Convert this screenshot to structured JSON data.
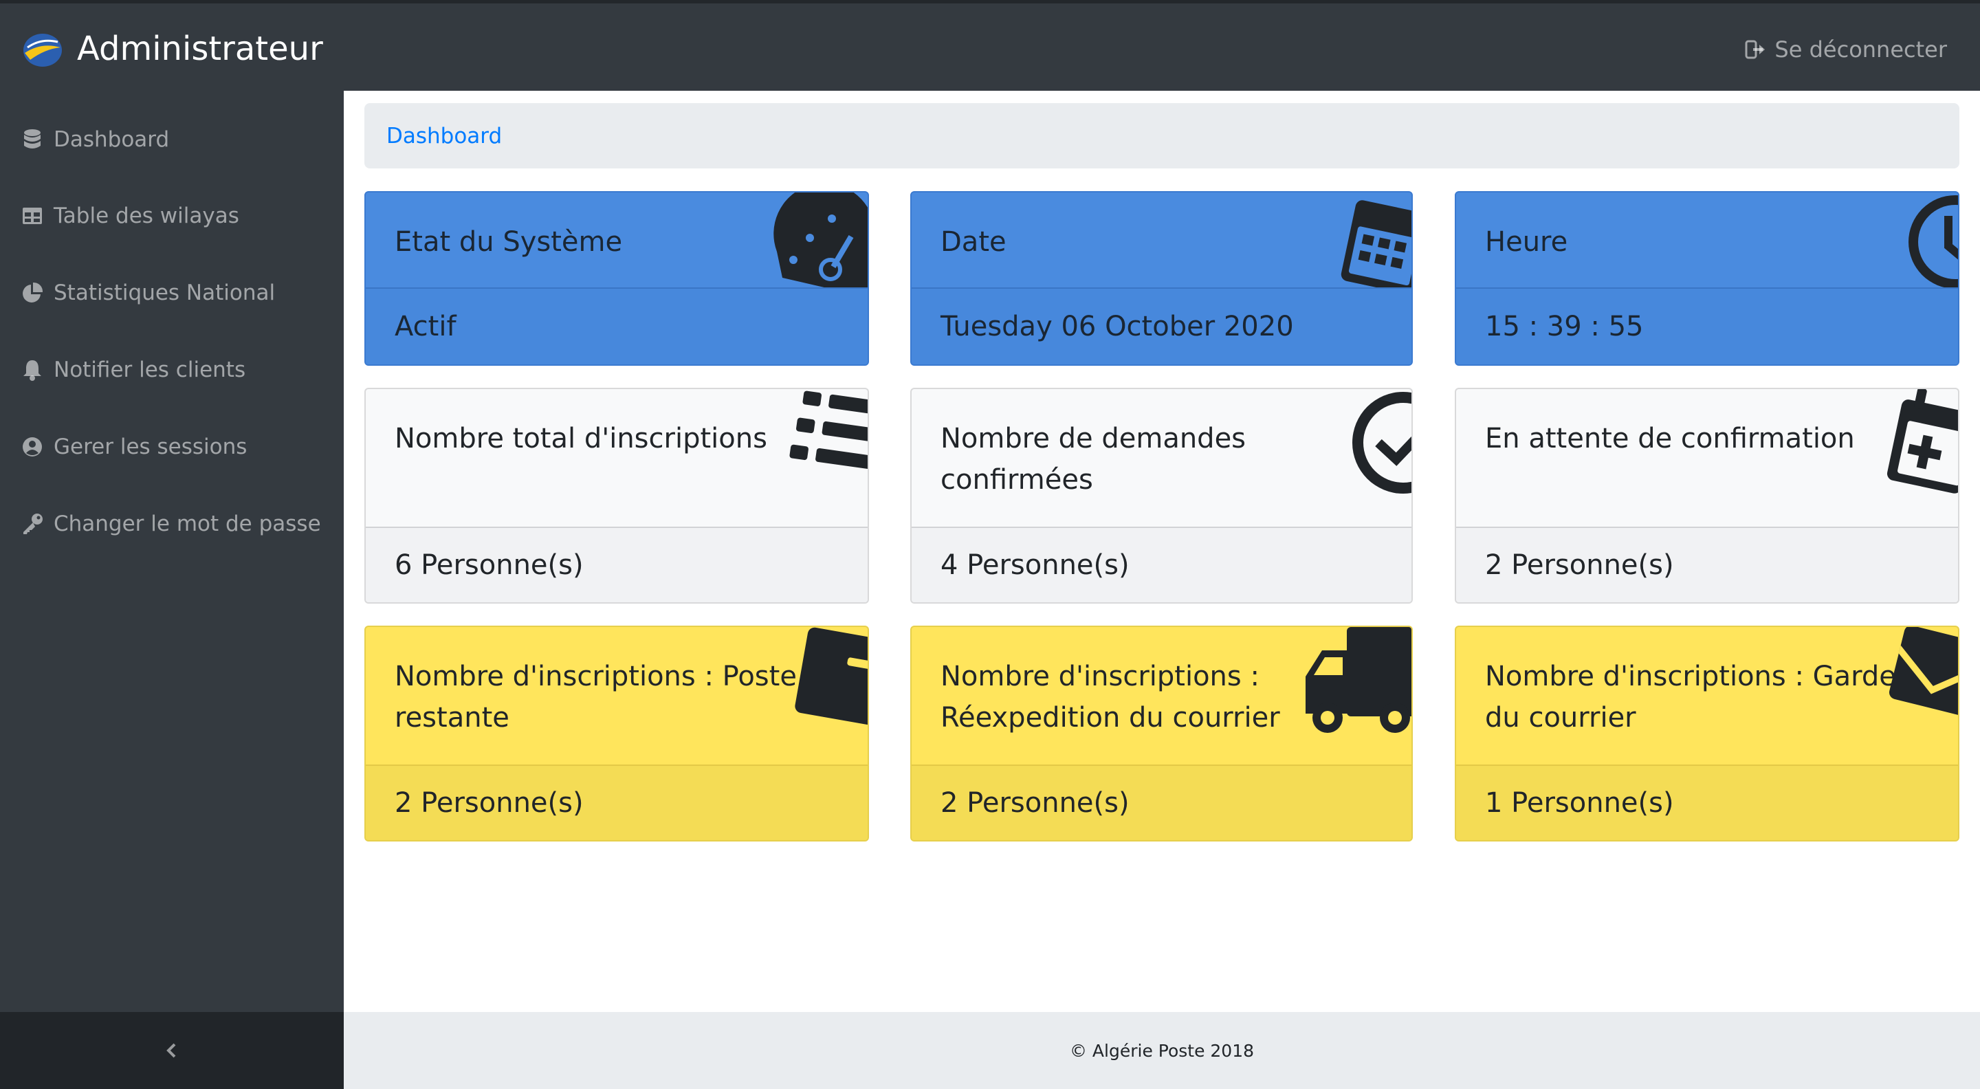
{
  "navbar": {
    "brand_title": "Administrateur",
    "logout_label": "Se déconnecter"
  },
  "sidebar": {
    "items": [
      {
        "label": "Dashboard",
        "icon": "database-icon"
      },
      {
        "label": "Table des wilayas",
        "icon": "table-icon"
      },
      {
        "label": "Statistiques National",
        "icon": "pie-chart-icon"
      },
      {
        "label": "Notifier les clients",
        "icon": "bell-icon"
      },
      {
        "label": "Gerer les sessions",
        "icon": "user-circle-icon"
      },
      {
        "label": "Changer le mot de passe",
        "icon": "key-icon"
      }
    ]
  },
  "breadcrumb": {
    "current": "Dashboard"
  },
  "cards": {
    "system": {
      "title": "Etat du Système",
      "value": "Actif",
      "icon": "tachometer-icon"
    },
    "date": {
      "title": "Date",
      "value": "Tuesday 06 October 2020",
      "icon": "calendar-icon"
    },
    "time": {
      "title": "Heure",
      "value": "15 : 39 : 55",
      "icon": "clock-icon"
    },
    "total": {
      "title": "Nombre total d'inscriptions",
      "value": "6 Personne(s)",
      "icon": "list-icon"
    },
    "confirmed": {
      "title": "Nombre de demandes confirmées",
      "value": "4 Personne(s)",
      "icon": "check-circle-icon"
    },
    "pending": {
      "title": "En attente de confirmation",
      "value": "2 Personne(s)",
      "icon": "calendar-plus-icon"
    },
    "poste_restante": {
      "title": "Nombre d'inscriptions : Poste restante",
      "value": "2 Personne(s)",
      "icon": "wallet-icon"
    },
    "reexpedition": {
      "title": "Nombre d'inscriptions : Réexpedition du courrier",
      "value": "2 Personne(s)",
      "icon": "truck-icon"
    },
    "garde": {
      "title": "Nombre d'inscriptions : Garde du courrier",
      "value": "1 Personne(s)",
      "icon": "envelope-icon"
    }
  },
  "footer": {
    "copyright": "© Algérie Poste 2018"
  },
  "colors": {
    "navbar": "#343a40",
    "primary_card": "#4a8bdf",
    "warning_card": "#ffe55c",
    "light_card": "#f8f9fa",
    "link": "#007bff"
  }
}
